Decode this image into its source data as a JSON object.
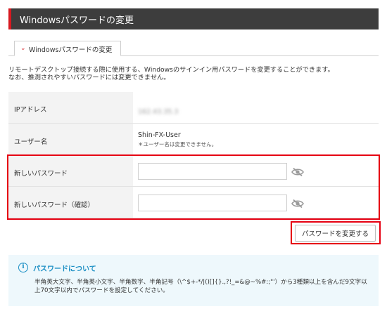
{
  "header": {
    "title": "Windowsパスワードの変更"
  },
  "tab": {
    "label": "Windowsパスワードの変更"
  },
  "intro": {
    "line1": "リモートデスクトップ接続する際に使用する、Windowsのサインイン用パスワードを変更することができます。",
    "line2": "なお、推測されやすいパスワードには変更できません。"
  },
  "form": {
    "ip": {
      "label": "IPアドレス",
      "value": "162.43.35.3"
    },
    "user": {
      "label": "ユーザー名",
      "value": "Shin-FX-User",
      "note": "＊ユーザー名は変更できません。"
    },
    "new_password": {
      "label": "新しいパスワード",
      "value": "",
      "placeholder": ""
    },
    "confirm_password": {
      "label": "新しいパスワード（確認）",
      "value": "",
      "placeholder": ""
    },
    "submit_label": "パスワードを変更する"
  },
  "info": {
    "title": "パスワードについて",
    "body": "半角英大文字、半角英小文字、半角数字、半角記号（\\^$+-*/|()[]{}.,?!_=&@~%#:;\"'）から3種類以上を含んだ9文字以上70文字以内でパスワードを設定してください。"
  },
  "colors": {
    "accent": "#d71920",
    "highlight": "#e60012",
    "info": "#1b8fc4",
    "header_bg": "#3d3d3d"
  },
  "icons": {
    "tab": "chevron-down-icon",
    "toggle": "eye-slash-icon",
    "info": "info-icon"
  }
}
